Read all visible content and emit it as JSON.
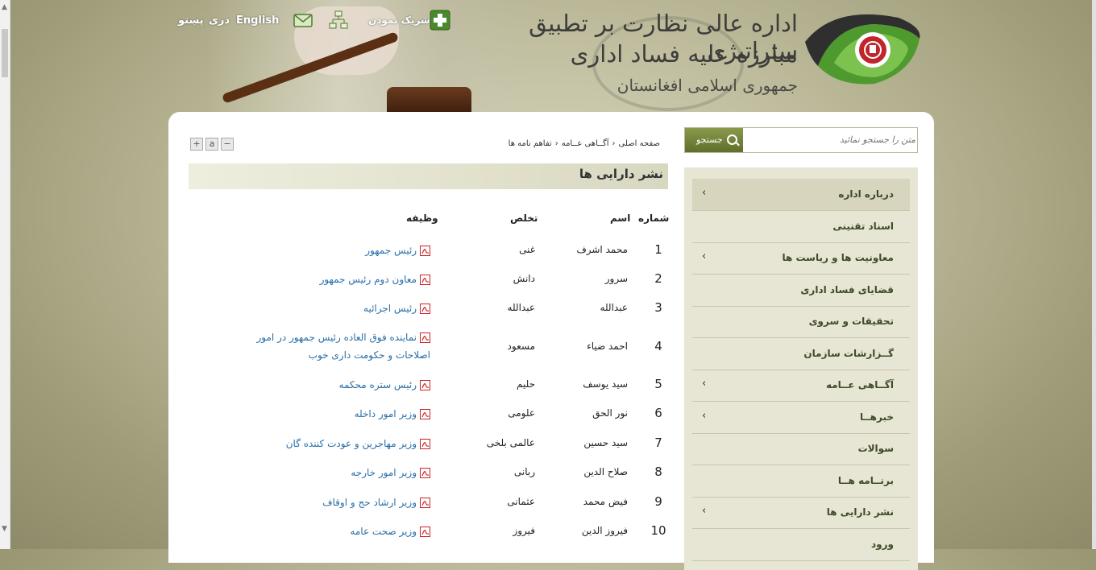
{
  "header": {
    "title_line1": "اداره عالی نظارت بر تطبیق ستراتیژی",
    "title_line2": "مبارزه علیه فساد اداری",
    "title_line3": "جمهوری اسلامی افغانستان",
    "links": {
      "pashto": "پښتو",
      "dari": "دری",
      "english": "English",
      "share": "شریک نمودن"
    }
  },
  "search": {
    "placeholder": "متن را جستجو نمائید",
    "button_label": "جستجو"
  },
  "sidebar": {
    "items": [
      {
        "label": "درباره اداره",
        "has_children": true
      },
      {
        "label": "اسناد تقنینی",
        "has_children": false
      },
      {
        "label": "معاونیت ها و ریاست ها",
        "has_children": true
      },
      {
        "label": "قضایای فساد اداری",
        "has_children": false
      },
      {
        "label": "تحقیقات و سروی",
        "has_children": false
      },
      {
        "label": "گــزارشات سازمان",
        "has_children": false
      },
      {
        "label": "آگــاهی عــامه",
        "has_children": true
      },
      {
        "label": "خبرهــا",
        "has_children": true
      },
      {
        "label": "سوالات",
        "has_children": false
      },
      {
        "label": "برنــامه هــا",
        "has_children": false
      },
      {
        "label": "نشر دارایی ها",
        "has_children": true
      },
      {
        "label": "ورود",
        "has_children": false
      }
    ]
  },
  "breadcrumb": [
    "صفحه اصلی",
    "آگــاهی عــامه",
    "تفاهم نامه ها"
  ],
  "font_tools": {
    "plus": "+",
    "reset": "a",
    "minus": "−"
  },
  "page_title": "نشر دارایی ها",
  "table": {
    "headers": {
      "num": "شماره",
      "name": "اسم",
      "alias": "تخلص",
      "duty": "وظیفه"
    },
    "rows": [
      {
        "num": "1",
        "name": "محمد اشرف",
        "alias": "غنی",
        "duty": "رئیس جمهور"
      },
      {
        "num": "2",
        "name": "سرور",
        "alias": "دانش",
        "duty": "معاون دوم رئیس جمهور"
      },
      {
        "num": "3",
        "name": "عبدالله",
        "alias": "عبدالله",
        "duty": "رئیس اجرائیه"
      },
      {
        "num": "4",
        "name": "احمد ضیاء",
        "alias": "مسعود",
        "duty": "نماینده فوق العاده رئیس جمهور در امور اصلاحات و حکومت داری خوب"
      },
      {
        "num": "5",
        "name": "سید یوسف",
        "alias": "حلیم",
        "duty": "رئیس ستره محکمه"
      },
      {
        "num": "6",
        "name": "نور الحق",
        "alias": "علومی",
        "duty": "وزیر امور داخله"
      },
      {
        "num": "7",
        "name": "سید حسین",
        "alias": "عالمی بلخی",
        "duty": "وزیر مهاجرین و عودت کننده گان"
      },
      {
        "num": "8",
        "name": "صلاح الدین",
        "alias": "ربانی",
        "duty": "وزیر امور خارجه"
      },
      {
        "num": "9",
        "name": "فیض محمد",
        "alias": "عثمانی",
        "duty": "وزیر ارشاد حج و اوقاف"
      },
      {
        "num": "10",
        "name": "فیروز الدین",
        "alias": "فیروز",
        "duty": "وزیر صحت عامه"
      }
    ]
  },
  "colors": {
    "accent_green": "#6b7b33",
    "link_blue": "#2a6fa8",
    "sidebar_bg": "#e7e5d3"
  },
  "icons": [
    "share-plus-icon",
    "sitemap-icon",
    "mail-icon",
    "pdf-icon",
    "search-icon",
    "chevron-left-icon"
  ]
}
